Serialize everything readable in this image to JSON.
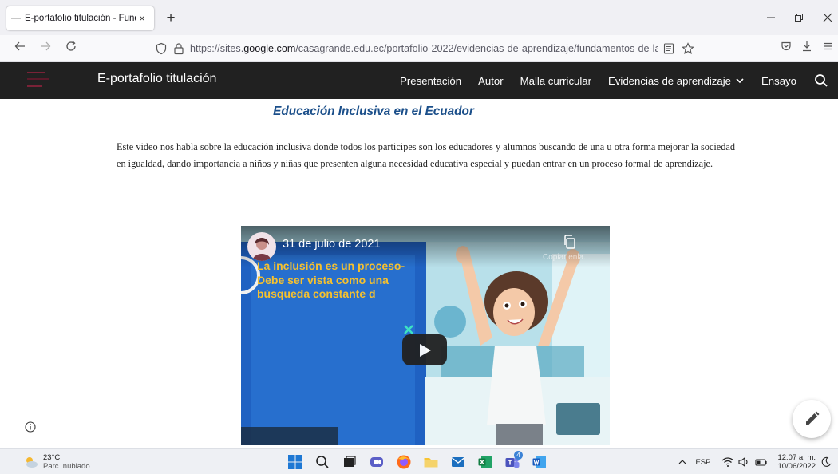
{
  "browser": {
    "tab_title": "E-portafolio titulación - Fundam",
    "tab_close": "×",
    "new_tab": "+",
    "url_prefix": "https://sites.",
    "url_domain": "google.com",
    "url_path": "/casagrande.edu.ec/portafolio-2022/evidencias-de-aprendizaje/fundamentos-de-la-educación"
  },
  "site": {
    "title": "E-portafolio titulación",
    "nav": [
      "Presentación",
      "Autor",
      "Malla curricular",
      "Evidencias de aprendizaje",
      "Ensayo"
    ]
  },
  "content": {
    "heading": "Educación Inclusiva en el Ecuador",
    "body": "Este video nos habla sobre la educación inclusiva donde todos los participes son los educadores y alumnos buscando de una u otra forma mejorar la sociedad en igualdad, dando importancia a niños y niñas que presenten alguna necesidad educativa especial y puedan entrar en un proceso formal de aprendizaje."
  },
  "video": {
    "date": "31 de julio de 2021",
    "copy_label": "Copiar enla...",
    "overlay_text": "La inclusión es un proceso-\nDebe ser vista como una\nbúsqueda constante d"
  },
  "taskbar": {
    "temperature": "23°C",
    "weather": "Parc. nublado",
    "language": "ESP",
    "time": "12:07 a. m.",
    "date": "10/06/2022",
    "teams_badge": "4"
  },
  "colors": {
    "header_bg": "#212121",
    "heading": "#1b4f8a",
    "video_blue": "#1f61c2",
    "video_text": "#f6c12e"
  }
}
